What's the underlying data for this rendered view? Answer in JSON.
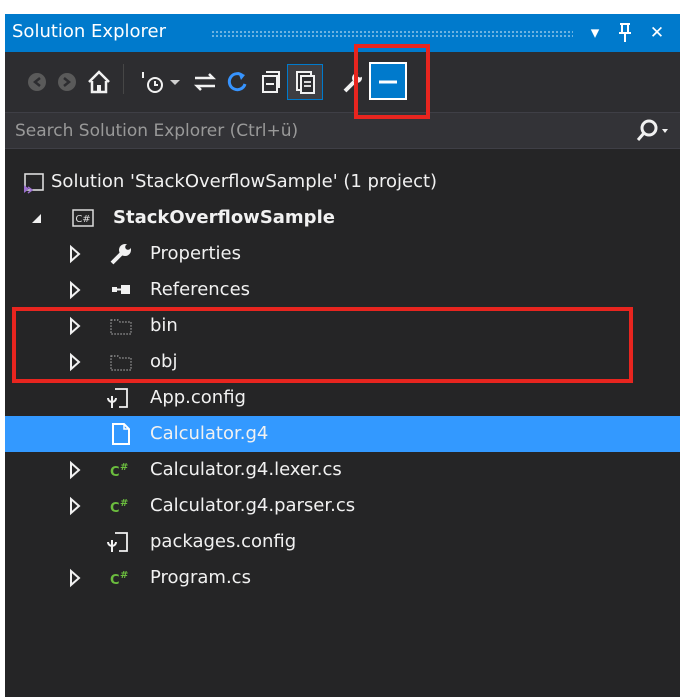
{
  "panel": {
    "title": "Solution Explorer",
    "dropdown_glyph": "▾",
    "pin_glyph": "ᵖ",
    "close_glyph": "✕"
  },
  "toolbar": {
    "icons": [
      "back-icon",
      "forward-icon",
      "home-icon",
      "pending-changes-filter-icon",
      "dropdown-arrow-icon",
      "sync-with-active-document-icon",
      "refresh-icon",
      "collapse-all-icon",
      "show-all-files-icon",
      "properties-wrench-icon",
      "preview-selected-items-icon"
    ],
    "highlighted_button": "show-all-files",
    "highlight_color": "#e8251f"
  },
  "search": {
    "placeholder": "Search Solution Explorer (Ctrl+ü)",
    "value": ""
  },
  "tree": {
    "solution": "Solution 'StackOverflowSample' (1 project)",
    "project": "StackOverflowSample",
    "items": [
      {
        "label": "Properties",
        "icon": "wrench-icon",
        "expandable": true
      },
      {
        "label": "References",
        "icon": "references-icon",
        "expandable": true
      },
      {
        "label": "bin",
        "icon": "hidden-folder-icon",
        "expandable": true
      },
      {
        "label": "obj",
        "icon": "hidden-folder-icon",
        "expandable": true
      },
      {
        "label": "App.config",
        "icon": "config-file-icon",
        "expandable": false
      },
      {
        "label": "Calculator.g4",
        "icon": "file-icon",
        "expandable": false,
        "selected": true
      },
      {
        "label": "Calculator.g4.lexer.cs",
        "icon": "csharp-file-icon",
        "expandable": true
      },
      {
        "label": "Calculator.g4.parser.cs",
        "icon": "csharp-file-icon",
        "expandable": true
      },
      {
        "label": "packages.config",
        "icon": "config-file-icon",
        "expandable": false
      },
      {
        "label": "Program.cs",
        "icon": "csharp-file-icon",
        "expandable": true
      }
    ]
  },
  "colors": {
    "accent": "#007acc",
    "selection": "#3399ff",
    "background": "#252526",
    "csharp_green": "#6bbd3e"
  }
}
